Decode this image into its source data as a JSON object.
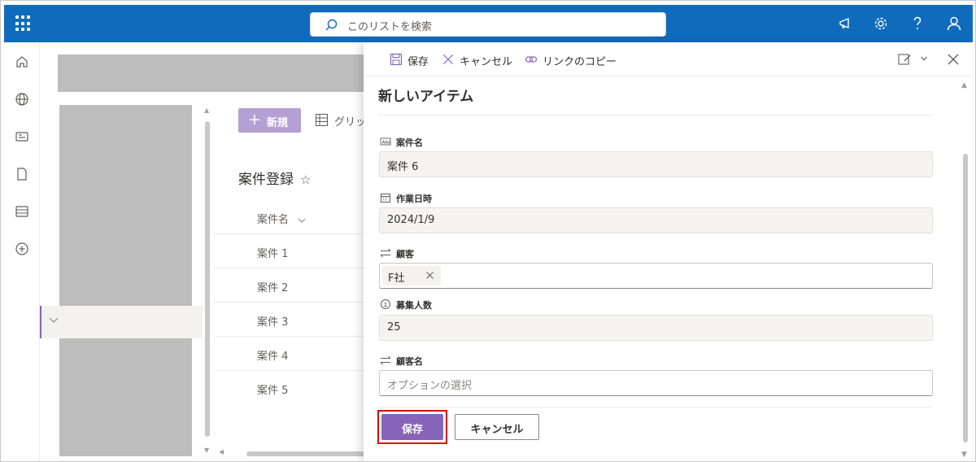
{
  "topbar": {
    "search_placeholder": "このリストを検索",
    "color": "#0f6cbd"
  },
  "rail": {
    "icons": [
      "home-icon",
      "globe-icon",
      "news-icon",
      "document-icon",
      "list-icon",
      "add-circle-icon"
    ]
  },
  "list": {
    "new_label": "新規",
    "grid_label": "グリッ",
    "title": "案件登録",
    "column_header": "案件名",
    "rows": [
      "案件 1",
      "案件 2",
      "案件 3",
      "案件 4",
      "案件 5"
    ]
  },
  "panel": {
    "commands": {
      "save": "保存",
      "cancel": "キャンセル",
      "copy_link": "リンクのコピー"
    },
    "title": "新しいアイテム",
    "fields": {
      "case_name": {
        "label": "案件名",
        "value": "案件 6"
      },
      "work_date": {
        "label": "作業日時",
        "value": "2024/1/9"
      },
      "customer": {
        "label": "顧客",
        "value": "F社"
      },
      "recruit_count": {
        "label": "募集人数",
        "value": "25"
      },
      "customer_name": {
        "label": "顧客名",
        "placeholder": "オプションの選択"
      }
    },
    "footer": {
      "save_label": "保存",
      "cancel_label": "キャンセル"
    },
    "accent": "#8764b8",
    "highlight": "#e00000"
  }
}
